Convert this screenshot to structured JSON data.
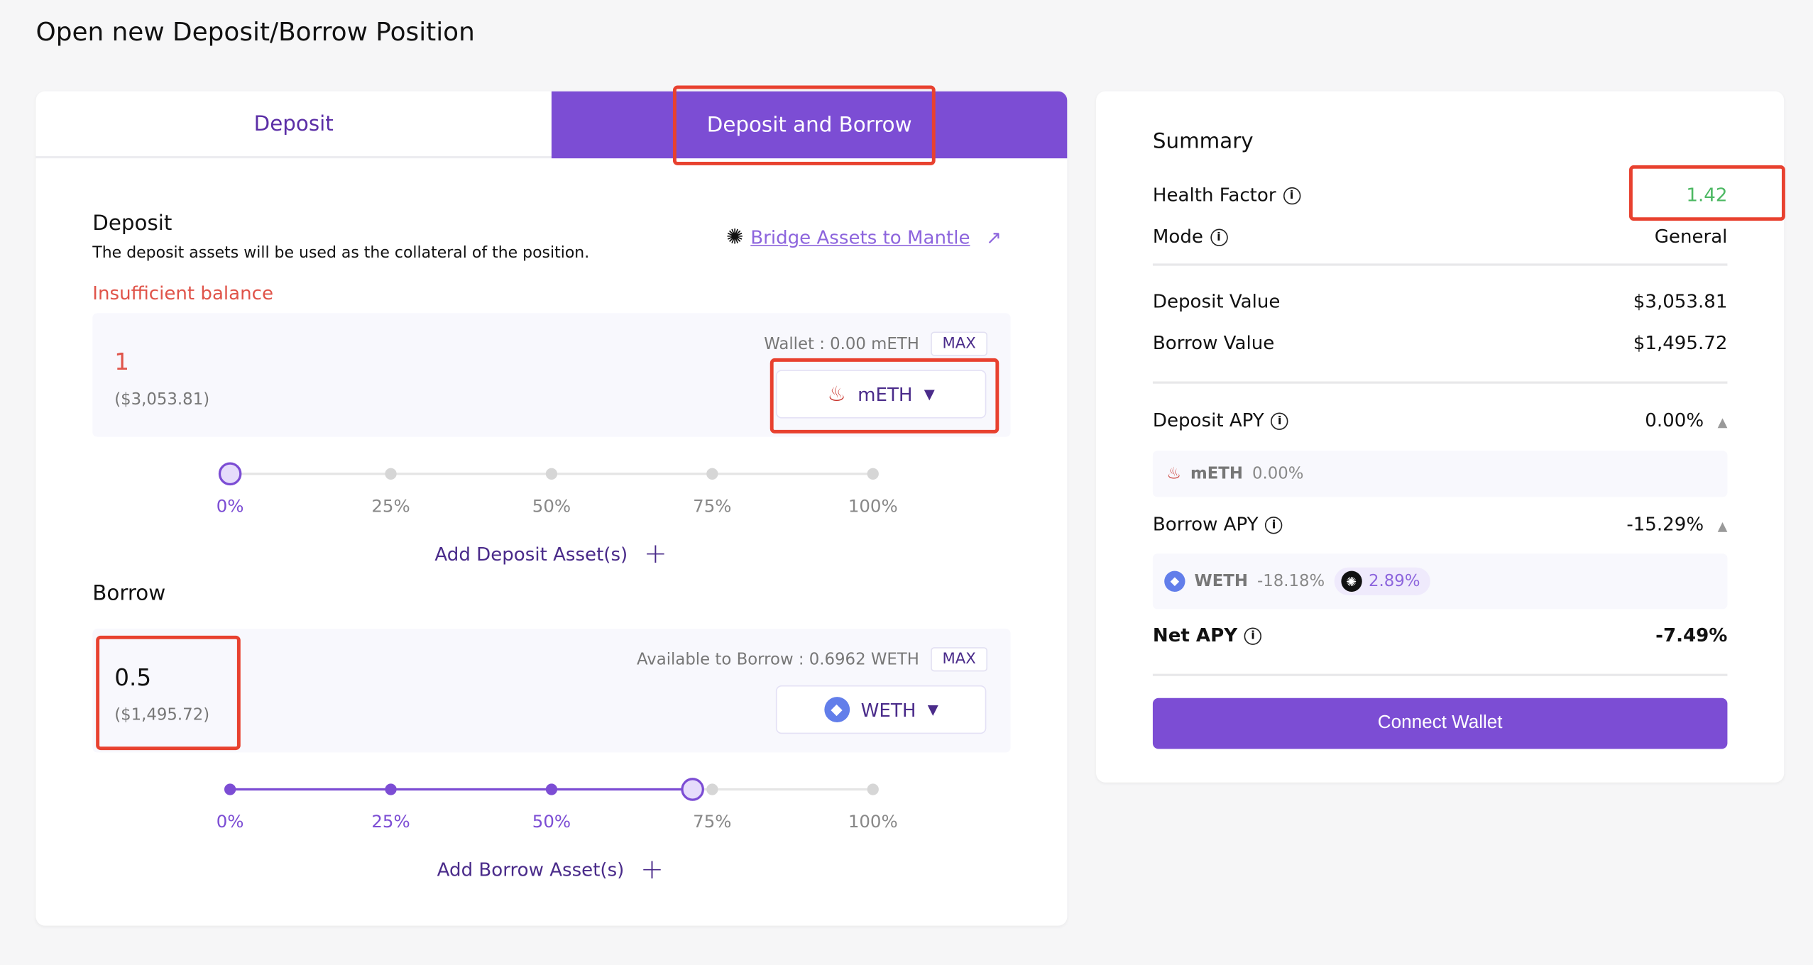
{
  "page_title": "Open new Deposit/Borrow Position",
  "tabs": [
    {
      "label": "Deposit",
      "active": false
    },
    {
      "label": "Deposit and Borrow",
      "active": true
    }
  ],
  "deposit": {
    "heading": "Deposit",
    "description": "The deposit assets will be used as the collateral of the position.",
    "bridge_link": "Bridge Assets to Mantle",
    "error": "Insufficient balance",
    "amount": "1",
    "amount_usd": "($3,053.81)",
    "wallet_label": "Wallet : 0.00 mETH",
    "max_label": "MAX",
    "asset": "mETH",
    "slider_percent": 0,
    "ticks": [
      "0%",
      "25%",
      "50%",
      "75%",
      "100%"
    ],
    "add_label": "Add Deposit Asset(s)"
  },
  "borrow": {
    "heading": "Borrow",
    "amount": "0.5",
    "amount_usd": "($1,495.72)",
    "available_label": "Available to Borrow : 0.6962 WETH",
    "max_label": "MAX",
    "asset": "WETH",
    "slider_percent": 72,
    "ticks": [
      "0%",
      "25%",
      "50%",
      "75%",
      "100%"
    ],
    "add_label": "Add Borrow Asset(s)"
  },
  "summary": {
    "title": "Summary",
    "health_factor_label": "Health Factor",
    "health_factor": "1.42",
    "mode_label": "Mode",
    "mode": "General",
    "deposit_value_label": "Deposit Value",
    "deposit_value": "$3,053.81",
    "borrow_value_label": "Borrow Value",
    "borrow_value": "$1,495.72",
    "deposit_apy_label": "Deposit APY",
    "deposit_apy": "0.00%",
    "deposit_apy_items": [
      {
        "asset": "mETH",
        "apy": "0.00%"
      }
    ],
    "borrow_apy_label": "Borrow APY",
    "borrow_apy": "-15.29%",
    "borrow_apy_items": [
      {
        "asset": "WETH",
        "apy": "-18.18%",
        "reward": "2.89%"
      }
    ],
    "net_apy_label": "Net APY",
    "net_apy": "-7.49%",
    "connect_label": "Connect Wallet"
  },
  "colors": {
    "accent": "#7c4dd4",
    "error": "#e0544a",
    "health_good": "#4cb862",
    "annotation": "#e8412f"
  }
}
